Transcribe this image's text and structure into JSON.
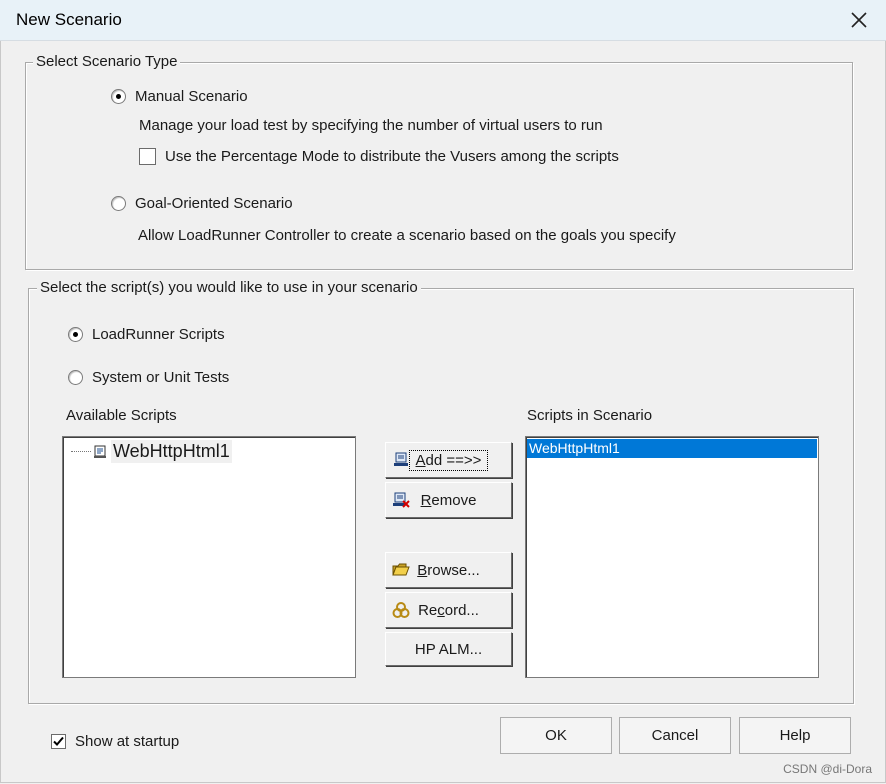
{
  "window": {
    "title": "New Scenario"
  },
  "scenario_type": {
    "legend": "Select Scenario Type",
    "manual": {
      "label": "Manual Scenario",
      "selected": true,
      "description": "Manage your load test by specifying the number of virtual users to run",
      "percentage_mode": {
        "label": "Use the Percentage Mode to distribute the Vusers among the scripts",
        "checked": false
      }
    },
    "goal": {
      "label": "Goal-Oriented Scenario",
      "selected": false,
      "description": "Allow LoadRunner Controller to create a scenario based on the goals you specify"
    }
  },
  "scripts": {
    "legend": "Select the script(s) you would like to use in your scenario",
    "loadrunner": {
      "label": "LoadRunner Scripts",
      "selected": true
    },
    "unit_tests": {
      "label": "System or Unit Tests",
      "selected": false
    },
    "available_label": "Available Scripts",
    "available": [
      "WebHttpHtml1"
    ],
    "in_scenario_label": "Scripts in Scenario",
    "in_scenario": [
      "WebHttpHtml1"
    ]
  },
  "buttons": {
    "add": {
      "pre": "A",
      "rest": "dd ==>>"
    },
    "remove": {
      "pre": "R",
      "rest": "emove"
    },
    "browse": {
      "pre": "B",
      "rest": "rowse..."
    },
    "record": {
      "pre": "Re",
      "u": "c",
      "rest": "ord..."
    },
    "hp_alm": "HP ALM...",
    "ok": "OK",
    "cancel": "Cancel",
    "help": "Help"
  },
  "show_at_startup": {
    "label": "Show at startup",
    "checked": true
  },
  "watermark": "CSDN @di-Dora"
}
